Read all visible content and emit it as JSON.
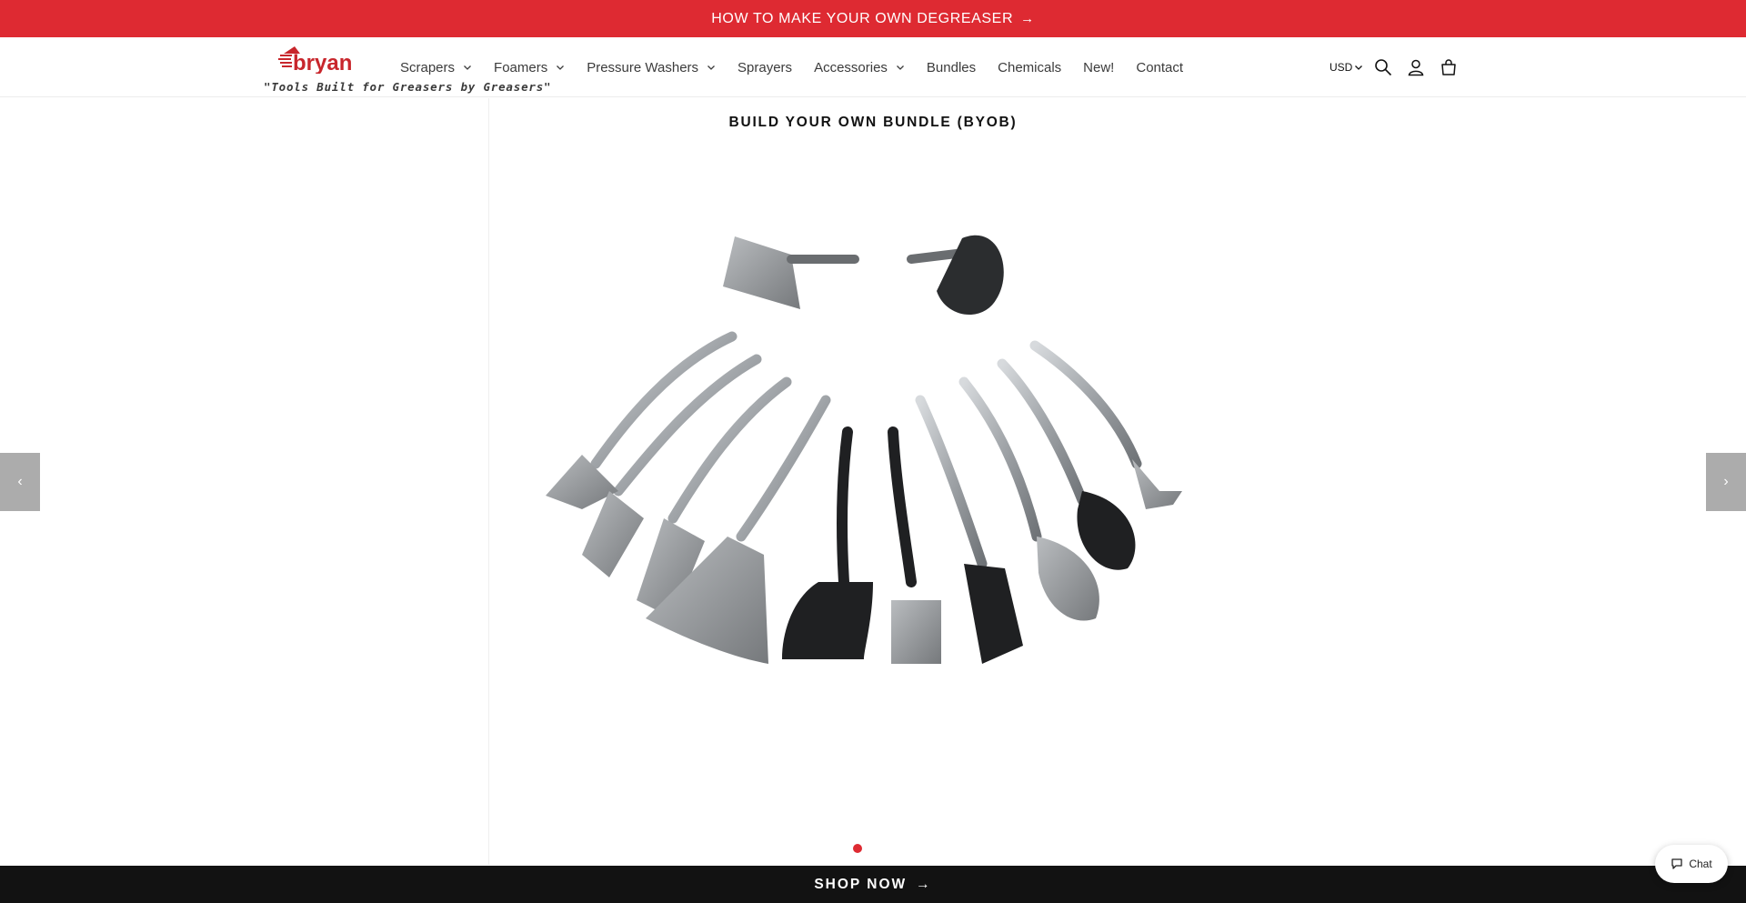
{
  "announcement": {
    "text": "HOW TO MAKE YOUR OWN DEGREASER",
    "arrow": "→"
  },
  "header": {
    "logo_text": "bryan",
    "tagline": "\"Tools Built for Greasers by Greasers\"",
    "nav": [
      {
        "label": "Scrapers",
        "dropdown": true
      },
      {
        "label": "Foamers",
        "dropdown": true
      },
      {
        "label": "Pressure Washers",
        "dropdown": true
      },
      {
        "label": "Sprayers",
        "dropdown": false
      },
      {
        "label": "Accessories",
        "dropdown": true
      },
      {
        "label": "Bundles",
        "dropdown": false
      },
      {
        "label": "Chemicals",
        "dropdown": false
      },
      {
        "label": "New!",
        "dropdown": false
      },
      {
        "label": "Contact",
        "dropdown": false
      }
    ],
    "currency": "USD",
    "icons": [
      "search-icon",
      "account-icon",
      "cart-icon"
    ]
  },
  "slideshow": {
    "title": "BUILD YOUR OWN BUNDLE (BYOB)",
    "prev_label": "‹",
    "next_label": "›",
    "slide_count": 1,
    "active_slide": 1
  },
  "shop_bar": {
    "label": "SHOP NOW",
    "arrow": "→"
  },
  "chat": {
    "label": "Chat"
  },
  "colors": {
    "brand_red": "#de2a32",
    "dark": "#121212",
    "text": "#3b3b3b"
  }
}
